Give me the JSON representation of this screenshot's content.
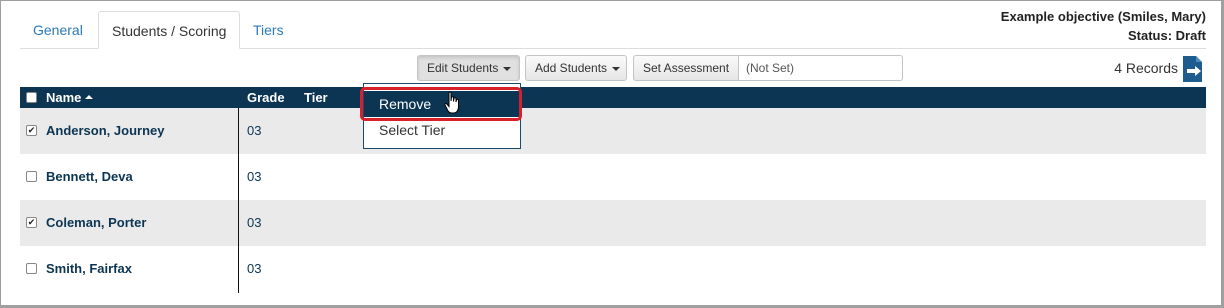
{
  "tabs": [
    {
      "label": "General"
    },
    {
      "label": "Students / Scoring"
    },
    {
      "label": "Tiers"
    }
  ],
  "header": {
    "objective": "Example objective (Smiles, Mary)",
    "status": "Status: Draft"
  },
  "toolbar": {
    "edit_students": "Edit Students",
    "add_students": "Add Students",
    "set_assessment": "Set Assessment",
    "assessment_value": "(Not Set)"
  },
  "records": "4 Records",
  "table": {
    "columns": {
      "name": "Name",
      "grade": "Grade",
      "tier": "Tier"
    },
    "rows": [
      {
        "name": "Anderson, Journey",
        "grade": "03",
        "checked": true
      },
      {
        "name": "Bennett, Deva",
        "grade": "03",
        "checked": false
      },
      {
        "name": "Coleman, Porter",
        "grade": "03",
        "checked": true
      },
      {
        "name": "Smith, Fairfax",
        "grade": "03",
        "checked": false
      }
    ]
  },
  "dropdown": {
    "items": [
      {
        "label": "Remove"
      },
      {
        "label": "Select Tier"
      }
    ]
  },
  "colors": {
    "header_bg": "#0c3553",
    "link": "#2a7ab8",
    "highlight": "#d6202a"
  },
  "icons": {
    "export": "export-icon",
    "sort": "sort-ascending-icon",
    "cursor": "hand-pointer-icon"
  }
}
